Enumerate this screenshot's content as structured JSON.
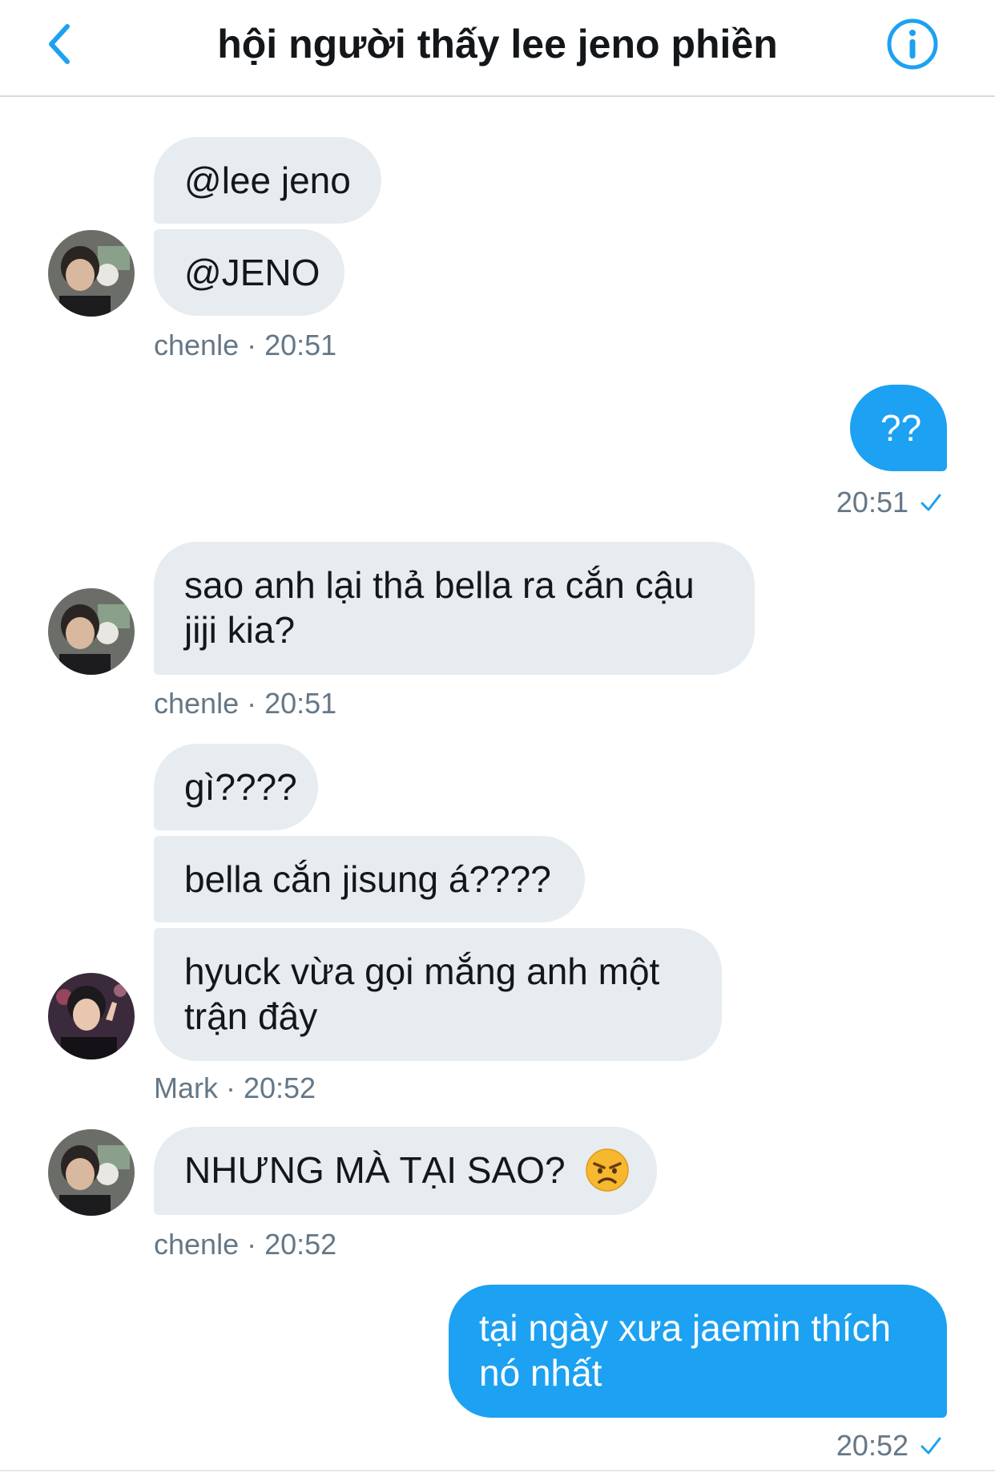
{
  "header": {
    "title": "hội người thấy lee jeno phiền",
    "back_icon": "chevron-left-icon",
    "info_icon": "info-icon",
    "accent_color": "#1da1f2"
  },
  "messages": [
    {
      "id": "m1",
      "direction": "in",
      "text": "@lee jeno"
    },
    {
      "id": "m2",
      "direction": "in",
      "text": "@JENO"
    },
    {
      "id": "m3",
      "direction": "out",
      "text": "??"
    },
    {
      "id": "m4",
      "direction": "in",
      "lines": [
        "sao anh lại thả bella ra cắn cậu",
        "jiji kia?"
      ]
    },
    {
      "id": "m5",
      "direction": "in",
      "text": "gì????"
    },
    {
      "id": "m6",
      "direction": "in",
      "text": "bella cắn jisung á????"
    },
    {
      "id": "m7",
      "direction": "in",
      "lines": [
        "hyuck vừa gọi mắng anh một",
        "trận đây"
      ]
    },
    {
      "id": "m8",
      "direction": "in",
      "text": "NHƯNG MÀ TẠI SAO?",
      "emoji": "angry-face-icon"
    },
    {
      "id": "m9",
      "direction": "out",
      "lines": [
        "tại ngày xưa jaemin thích",
        "nó nhất"
      ]
    }
  ],
  "meta": {
    "g1": "chenle · 20:51",
    "g2": "20:51",
    "g3": "chenle · 20:51",
    "g4": "Mark  · 20:52",
    "g5": "chenle · 20:52",
    "g6": "20:52"
  },
  "colors": {
    "incoming_bubble": "#e6ecf0",
    "outgoing_bubble": "#1da1f2",
    "meta_text": "#657786"
  }
}
